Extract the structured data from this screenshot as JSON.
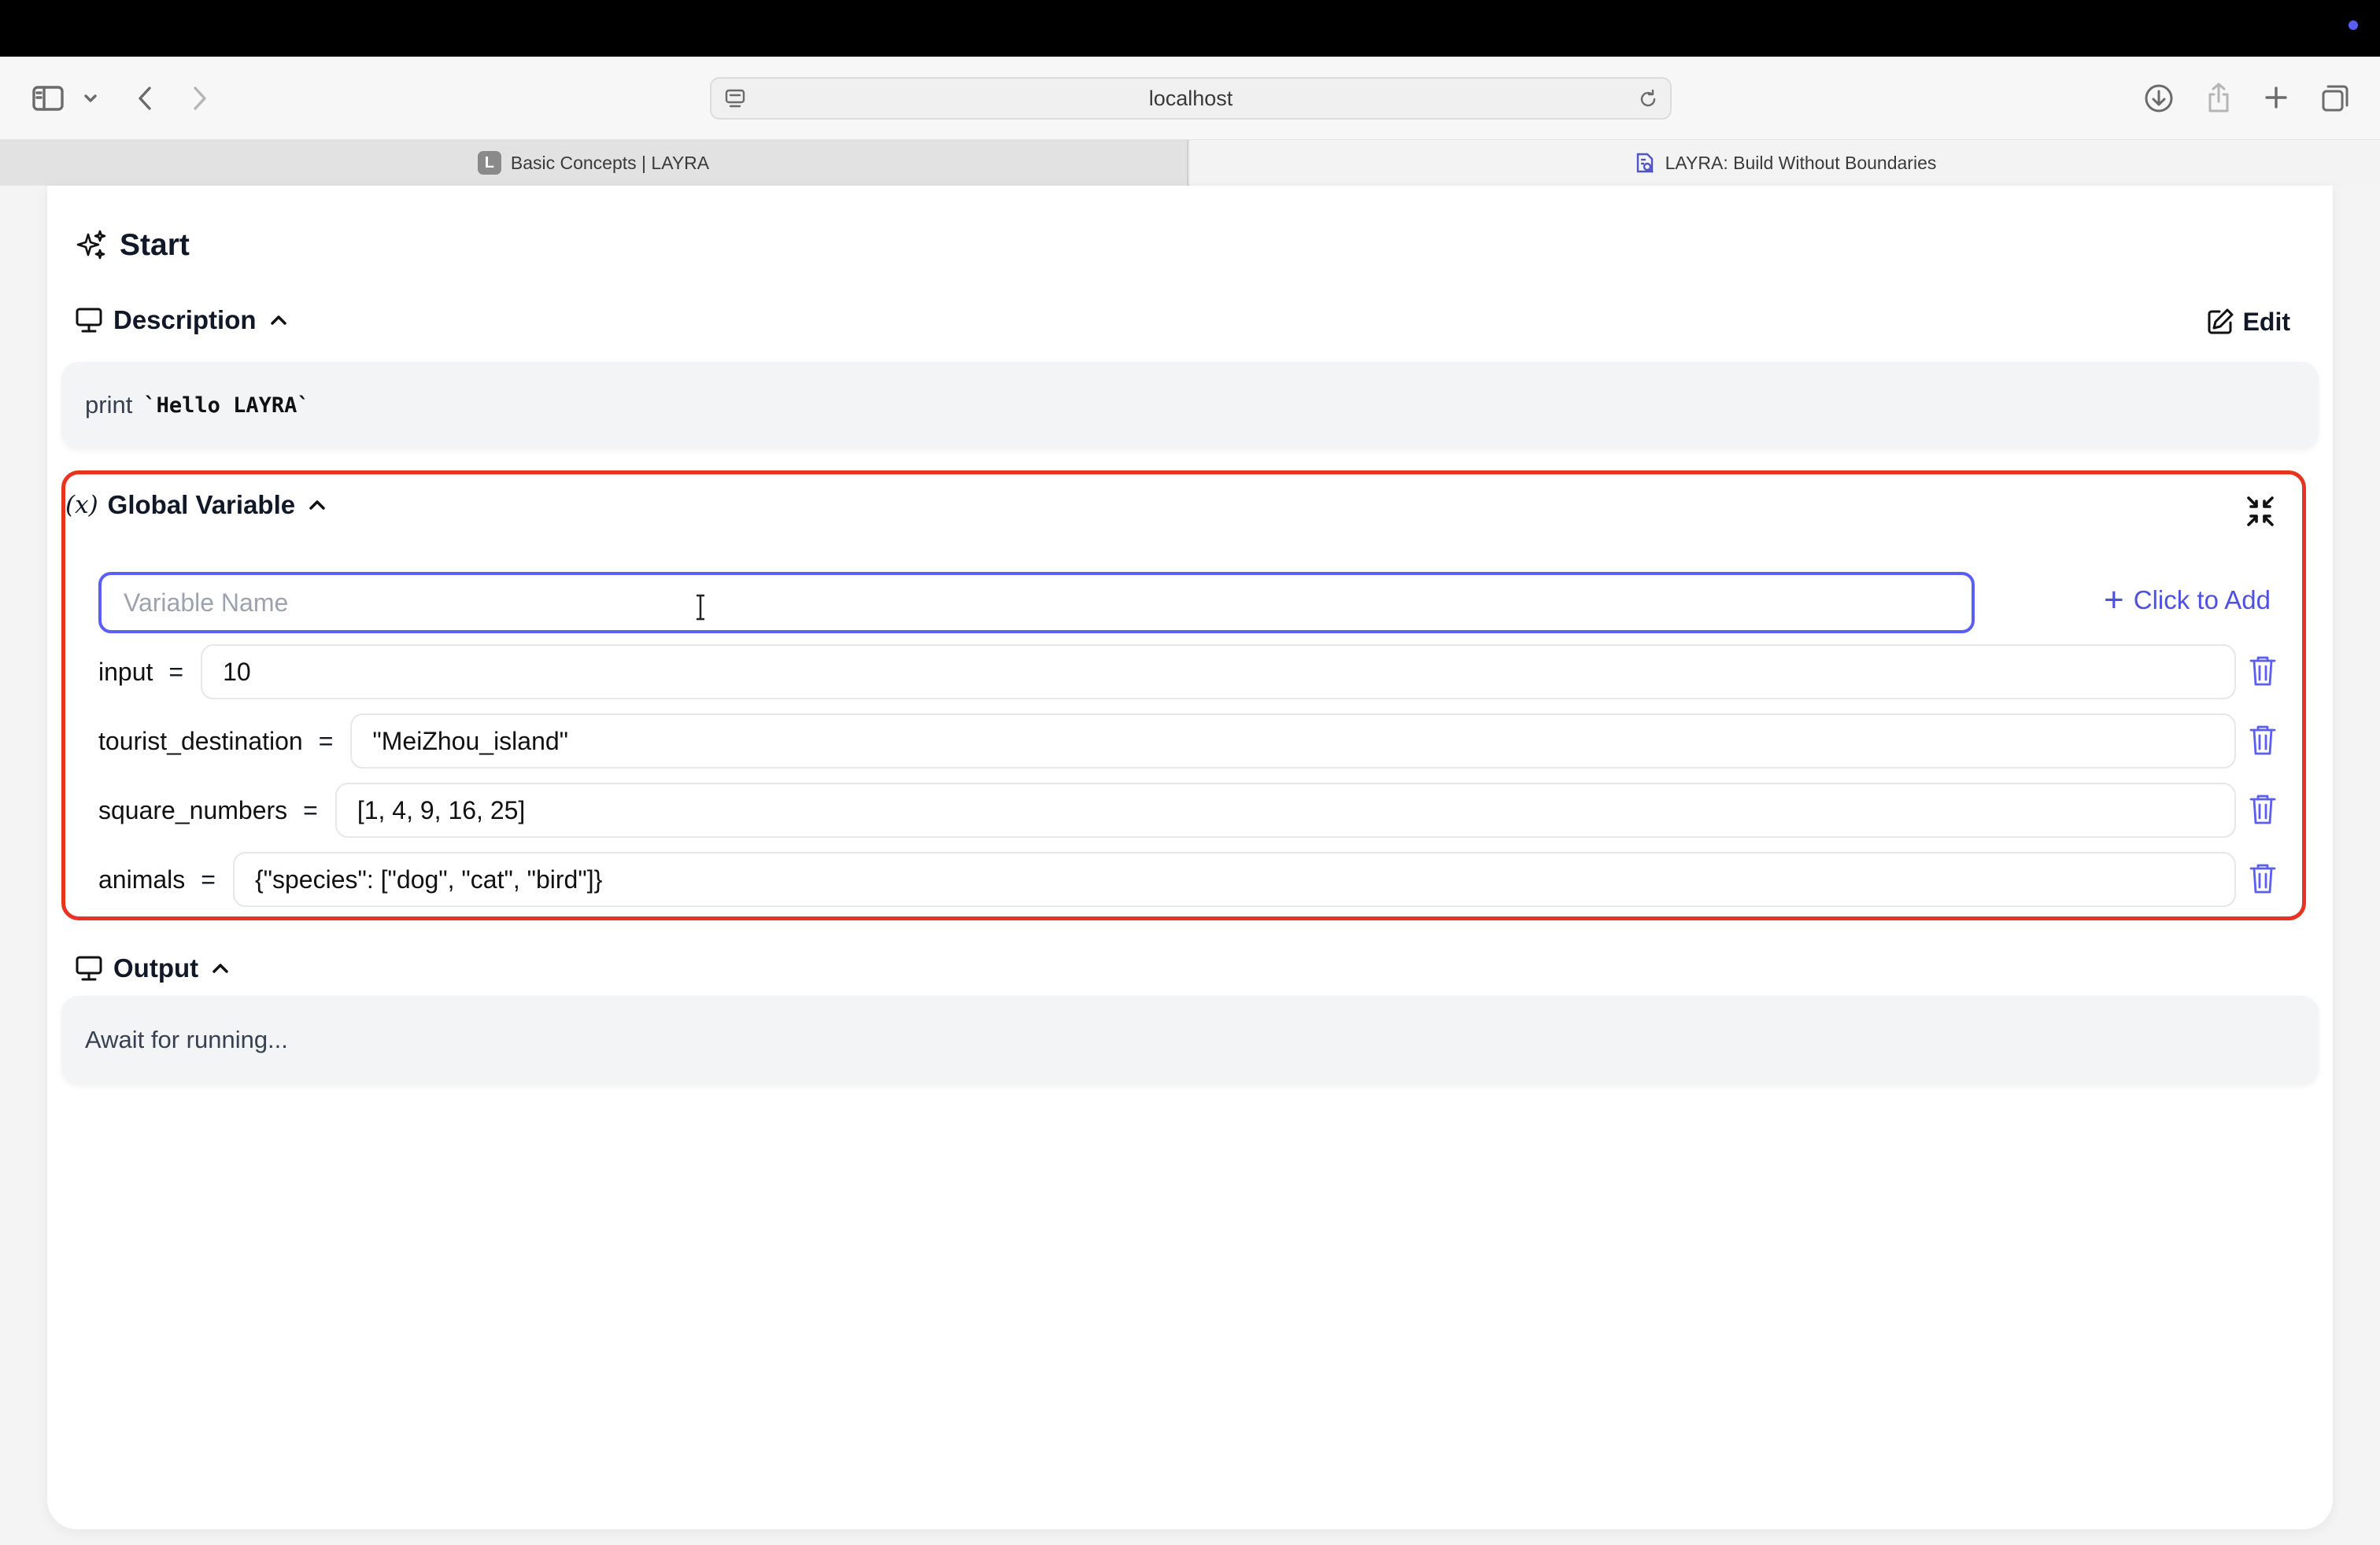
{
  "browser": {
    "url": "localhost",
    "tabs": [
      {
        "label": "Basic Concepts | LAYRA",
        "favicon_letter": "L",
        "active": false
      },
      {
        "label": "LAYRA: Build Without Boundaries",
        "active": true
      }
    ]
  },
  "node": {
    "title": "Start",
    "description": {
      "label": "Description",
      "edit_label": "Edit",
      "prefix": "print",
      "code": "`Hello LAYRA`"
    },
    "global_variable": {
      "label": "Global Variable",
      "name_placeholder": "Variable Name",
      "add_label": "Click to Add",
      "variables": [
        {
          "name": "input",
          "value": "10"
        },
        {
          "name": "tourist_destination",
          "value": "\"MeiZhou_island\""
        },
        {
          "name": "square_numbers",
          "value": "[1, 4, 9, 16, 25]"
        },
        {
          "name": "animals",
          "value": "{\"species\": [\"dog\", \"cat\", \"bird\"]}"
        }
      ]
    },
    "output": {
      "label": "Output",
      "text": "Await for running..."
    }
  },
  "colors": {
    "accent": "#5b5ef5",
    "highlight_border": "#e9321f"
  },
  "icons": {
    "title": "sparkles-icon",
    "description": "monitor-icon",
    "edit": "pencil-square-icon",
    "global_variable": "variable-icon",
    "collapse": "arrows-collapse-icon",
    "delete": "trash-icon",
    "output": "monitor-icon"
  }
}
